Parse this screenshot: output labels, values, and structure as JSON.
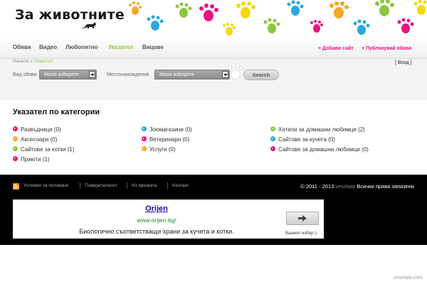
{
  "header": {
    "logo_text": "За животните"
  },
  "nav": {
    "items": [
      {
        "label": "Обяви"
      },
      {
        "label": "Видео"
      },
      {
        "label": "Любопитно"
      },
      {
        "label": "Указател"
      },
      {
        "label": "Вицове"
      }
    ],
    "active_index": 3,
    "right": [
      {
        "label": "+ Добави сайт"
      },
      {
        "label": "+ Публикувай обява"
      }
    ]
  },
  "breadcrumb": {
    "home": "Начало",
    "sep": " » ",
    "current": "Указател"
  },
  "login": {
    "label": "[ Вход ]"
  },
  "search": {
    "type_label": "Вид обява",
    "type_value": "Моля изберете",
    "location_label": "Местонахождение",
    "location_value": "Моля изберете",
    "button_label": "Search"
  },
  "directory": {
    "title": "Указател по категории",
    "columns": [
      [
        {
          "label": "Развъдници (0)",
          "color": "#e5157f"
        },
        {
          "label": "Аксесоари (0)",
          "color": "#f5a623"
        },
        {
          "label": "Сайтове за котки (1)",
          "color": "#8bc63f"
        },
        {
          "label": "Приюти (1)",
          "color": "#e5157f"
        }
      ],
      [
        {
          "label": "Зоомагазини (0)",
          "color": "#29a8df"
        },
        {
          "label": "Ветеринари (0)",
          "color": "#e5157f"
        },
        {
          "label": "Услуги (0)",
          "color": "#f5a623"
        }
      ],
      [
        {
          "label": "Хотели за домашни любимци (2)",
          "color": "#8bc63f"
        },
        {
          "label": "Сайтове за кучета (0)",
          "color": "#29a8df"
        },
        {
          "label": "Сайтове за домашни любимци (0)",
          "color": "#e5157f"
        }
      ]
    ]
  },
  "footer": {
    "links": [
      {
        "label": "Условия за ползване"
      },
      {
        "label": "Поверителност"
      },
      {
        "label": "Из мрежата"
      },
      {
        "label": "Контакт"
      }
    ],
    "copyright_prefix": "© 2011 - 2013",
    "copyright_brand": "veselata",
    "copyright_suffix": "Всички права запазени"
  },
  "ad": {
    "title": "Orijen",
    "url": "www.orijen.bg/",
    "description": "Биологично съответстващи храни за кучета и котки.",
    "choices_label": "Вашият избор ▷"
  },
  "watermark": "veselata.com",
  "colors": {
    "accent_green": "#8bc63f",
    "accent_pink": "#e5157f",
    "accent_blue": "#29a8df",
    "accent_orange": "#f5a623",
    "footer_bg": "#000000"
  },
  "icons": [
    "cat-silhouette-icon",
    "paw-print-icon",
    "dropdown-arrow-icon",
    "rss-icon",
    "arrow-right-icon",
    "bullet-arrow-icon"
  ]
}
